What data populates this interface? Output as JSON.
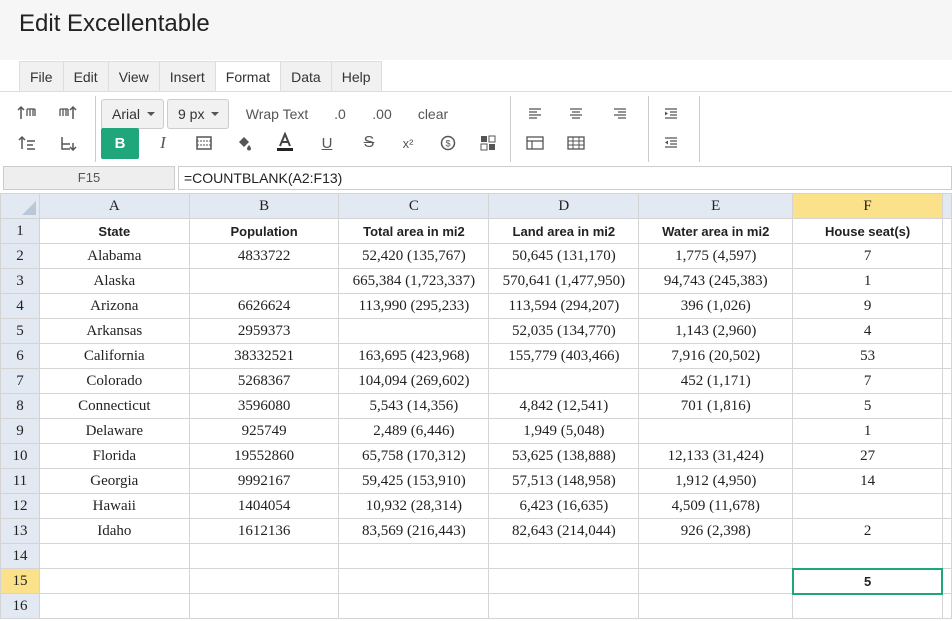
{
  "app": {
    "title": "Edit Excellentable"
  },
  "menus": [
    "File",
    "Edit",
    "View",
    "Insert",
    "Format",
    "Data",
    "Help"
  ],
  "toolbar": {
    "font_family": "Arial",
    "font_size": "9 px",
    "wrap_text": "Wrap Text",
    "decrease_decimal": ".0",
    "increase_decimal": ".00",
    "clear": "clear",
    "bold": "B",
    "italic": "I",
    "strikethrough": "S",
    "superscript": "x²",
    "currency": "$"
  },
  "formula_bar": {
    "cell_ref": "F15",
    "formula": "=COUNTBLANK(A2:F13)"
  },
  "sheet": {
    "columns": [
      "A",
      "B",
      "C",
      "D",
      "E",
      "F"
    ],
    "active_column": "F",
    "active_row": "15",
    "rows": [
      {
        "num": "1",
        "cells": [
          "State",
          "Population",
          "Total area in mi2",
          "Land area in mi2",
          "Water area in mi2",
          "House seat(s)"
        ]
      },
      {
        "num": "2",
        "cells": [
          "Alabama",
          "4833722",
          "52,420 (135,767)",
          "50,645 (131,170)",
          "1,775 (4,597)",
          "7"
        ]
      },
      {
        "num": "3",
        "cells": [
          "Alaska",
          "",
          "665,384 (1,723,337)",
          "570,641 (1,477,950)",
          "94,743 (245,383)",
          "1"
        ]
      },
      {
        "num": "4",
        "cells": [
          "Arizona",
          "6626624",
          "113,990 (295,233)",
          "113,594 (294,207)",
          "396 (1,026)",
          "9"
        ]
      },
      {
        "num": "5",
        "cells": [
          "Arkansas",
          "2959373",
          "",
          "52,035 (134,770)",
          "1,143 (2,960)",
          "4"
        ]
      },
      {
        "num": "6",
        "cells": [
          "California",
          "38332521",
          "163,695 (423,968)",
          "155,779 (403,466)",
          "7,916 (20,502)",
          "53"
        ]
      },
      {
        "num": "7",
        "cells": [
          "Colorado",
          "5268367",
          "104,094 (269,602)",
          "",
          "452 (1,171)",
          "7"
        ]
      },
      {
        "num": "8",
        "cells": [
          "Connecticut",
          "3596080",
          "5,543 (14,356)",
          "4,842 (12,541)",
          "701 (1,816)",
          "5"
        ]
      },
      {
        "num": "9",
        "cells": [
          "Delaware",
          "925749",
          "2,489 (6,446)",
          "1,949 (5,048)",
          "",
          "1"
        ]
      },
      {
        "num": "10",
        "cells": [
          "Florida",
          "19552860",
          "65,758 (170,312)",
          "53,625 (138,888)",
          "12,133 (31,424)",
          "27"
        ]
      },
      {
        "num": "11",
        "cells": [
          "Georgia",
          "9992167",
          "59,425 (153,910)",
          "57,513 (148,958)",
          "1,912 (4,950)",
          "14"
        ]
      },
      {
        "num": "12",
        "cells": [
          "Hawaii",
          "1404054",
          "10,932 (28,314)",
          "6,423 (16,635)",
          "4,509 (11,678)",
          ""
        ]
      },
      {
        "num": "13",
        "cells": [
          "Idaho",
          "1612136",
          "83,569 (216,443)",
          "82,643 (214,044)",
          "926 (2,398)",
          "2"
        ]
      },
      {
        "num": "14",
        "cells": [
          "",
          "",
          "",
          "",
          "",
          ""
        ]
      },
      {
        "num": "15",
        "cells": [
          "",
          "",
          "",
          "",
          "",
          "5"
        ]
      },
      {
        "num": "16",
        "cells": [
          "",
          "",
          "",
          "",
          "",
          ""
        ]
      }
    ]
  },
  "colors": {
    "accent": "#1fa67a",
    "header_bg": "#e3e9f3",
    "active_header_bg": "#fbe28a"
  }
}
